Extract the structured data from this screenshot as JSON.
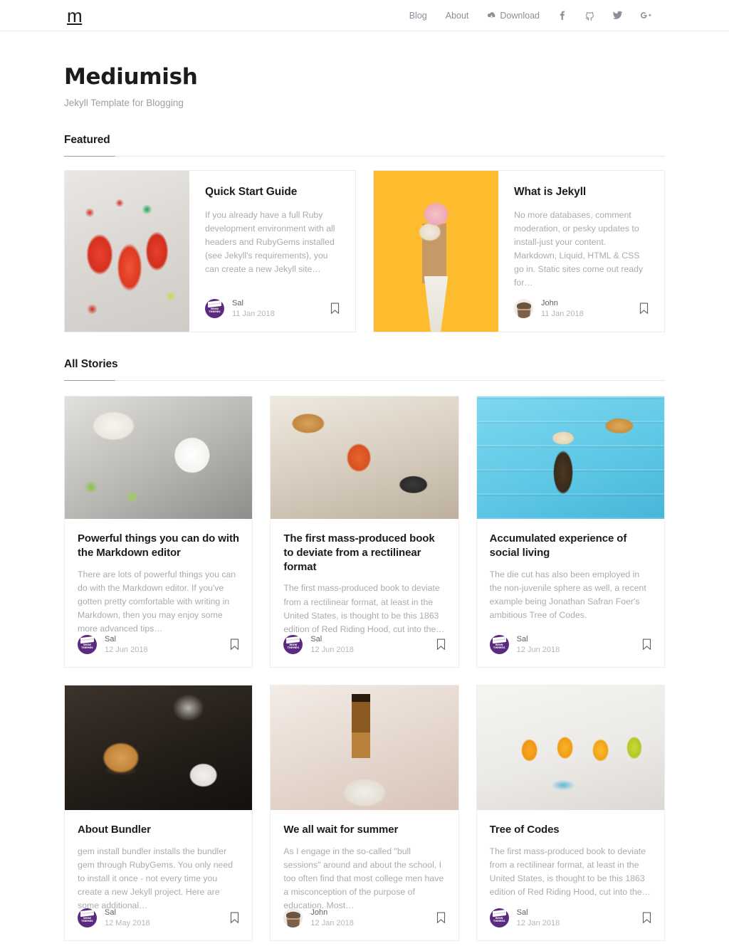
{
  "navbar": {
    "brand": "m",
    "links": [
      {
        "label": "Blog",
        "name": "nav-link-blog"
      },
      {
        "label": "About",
        "name": "nav-link-about"
      },
      {
        "label": "Download",
        "name": "nav-link-download",
        "icon": "cloud-download-icon"
      }
    ],
    "social": [
      {
        "name": "facebook-icon",
        "label": "f"
      },
      {
        "name": "github-icon",
        "label": ""
      },
      {
        "name": "twitter-icon",
        "label": ""
      },
      {
        "name": "google-plus-icon",
        "label": "G+"
      }
    ]
  },
  "header": {
    "title": "Mediumish",
    "subtitle": "Jekyll Template for Blogging"
  },
  "sections": {
    "featured_title": "Featured",
    "all_stories_title": "All Stories"
  },
  "featured": [
    {
      "title": "Quick Start Guide",
      "excerpt": "If you already have a full Ruby development environment with all headers and RubyGems installed (see Jekyll's requirements), you can create a new Jekyll site…",
      "author": "Sal",
      "date": "11 Jan 2018",
      "avatar": "wow-themes-avatar",
      "image": "cocktails-photo"
    },
    {
      "title": "What is Jekyll",
      "excerpt": "No more databases, comment moderation, or pesky updates to install-just your content. Markdown, Liquid, HTML & CSS go in. Static sites come out ready for…",
      "author": "John",
      "date": "11 Jan 2018",
      "avatar": "john-photo-avatar",
      "image": "ice-cream-cone-photo"
    }
  ],
  "stories_row1": [
    {
      "title": "Powerful things you can do with the Markdown editor",
      "excerpt": "There are lots of powerful things you can do with the Markdown editor. If you've gotten pretty comfortable with writing in Markdown, then you may enjoy some more advanced tips…",
      "author": "Sal",
      "date": "12 Jun 2018",
      "avatar": "wow-themes-avatar",
      "image": "coffee-latte-photo"
    },
    {
      "title": "The first mass-produced book to deviate from a rectilinear format",
      "excerpt": "The first mass-produced book to deviate from a rectilinear format, at least in the United States, is thought to be this 1863 edition of Red Riding Hood, cut into the…",
      "author": "Sal",
      "date": "12 Jun 2018",
      "avatar": "wow-themes-avatar",
      "image": "negroni-cocktail-photo"
    },
    {
      "title": "Accumulated experience of social living",
      "excerpt": "The die cut has also been employed in the non-juvenile sphere as well, a recent example being Jonathan Safran Foer's ambitious Tree of Codes.",
      "author": "Sal",
      "date": "12 Jun 2018",
      "avatar": "wow-themes-avatar",
      "image": "iced-coffee-blue-wood-photo"
    }
  ],
  "stories_row2": [
    {
      "title": "About Bundler",
      "excerpt": "gem install bundler installs the bundler gem through RubyGems. You only need to install it once - not every time you create a new Jekyll project. Here are some additional…",
      "author": "Sal",
      "date": "12 May 2018",
      "avatar": "wow-themes-avatar",
      "image": "burger-dinner-photo"
    },
    {
      "title": "We all wait for summer",
      "excerpt": "As I engage in the so-called \"bull sessions\" around and about the school, I too often find that most college men have a misconception of the purpose of education. Most…",
      "author": "John",
      "date": "12 Jan 2018",
      "avatar": "john-photo-avatar",
      "image": "whiskey-bottle-photo"
    },
    {
      "title": "Tree of Codes",
      "excerpt": "The first mass-produced book to deviate from a rectilinear format, at least in the United States, is thought to be this 1863 edition of Red Riding Hood, cut into the…",
      "author": "Sal",
      "date": "12 Jan 2018",
      "avatar": "wow-themes-avatar",
      "image": "mimosa-glasses-photo"
    }
  ],
  "colors": {
    "brand_dark": "#1c1c1c",
    "muted_text": "#a7acb3",
    "border": "#ededed",
    "avatar_purple": "#5b2a7e",
    "accent_yellow": "#fcbc2e"
  }
}
